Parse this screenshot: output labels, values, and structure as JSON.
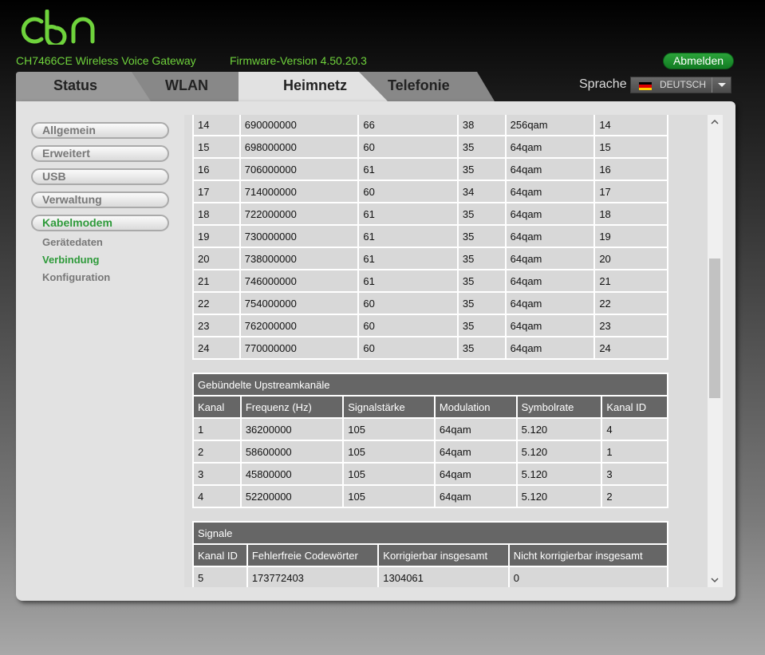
{
  "header": {
    "model": "CH7466CE  Wireless Voice Gateway",
    "firmware": "Firmware-Version  4.50.20.3",
    "logout_label": "Abmelden",
    "language_label": "Sprache",
    "language_value": "DEUTSCH",
    "brand_color": "#6fd33c"
  },
  "tabs": [
    "Status",
    "WLAN",
    "Heimnetz",
    "Telefonie"
  ],
  "sidebar": {
    "buttons": [
      "Allgemein",
      "Erweitert",
      "USB",
      "Verwaltung",
      "Kabelmodem"
    ],
    "subitems": [
      "Gerätedaten",
      "Verbindung",
      "Konfiguration"
    ]
  },
  "downstream_rows": [
    [
      "14",
      "690000000",
      "66",
      "38",
      "256qam",
      "14"
    ],
    [
      "15",
      "698000000",
      "60",
      "35",
      "64qam",
      "15"
    ],
    [
      "16",
      "706000000",
      "61",
      "35",
      "64qam",
      "16"
    ],
    [
      "17",
      "714000000",
      "60",
      "34",
      "64qam",
      "17"
    ],
    [
      "18",
      "722000000",
      "61",
      "35",
      "64qam",
      "18"
    ],
    [
      "19",
      "730000000",
      "61",
      "35",
      "64qam",
      "19"
    ],
    [
      "20",
      "738000000",
      "61",
      "35",
      "64qam",
      "20"
    ],
    [
      "21",
      "746000000",
      "61",
      "35",
      "64qam",
      "21"
    ],
    [
      "22",
      "754000000",
      "60",
      "35",
      "64qam",
      "22"
    ],
    [
      "23",
      "762000000",
      "60",
      "35",
      "64qam",
      "23"
    ],
    [
      "24",
      "770000000",
      "60",
      "35",
      "64qam",
      "24"
    ]
  ],
  "upstream": {
    "title": "Gebündelte Upstreamkanäle",
    "headers": [
      "Kanal",
      "Frequenz (Hz)",
      "Signalstärke",
      "Modulation",
      "Symbolrate",
      "Kanal ID"
    ],
    "rows": [
      [
        "1",
        "36200000",
        "105",
        "64qam",
        "5.120",
        "4"
      ],
      [
        "2",
        "58600000",
        "105",
        "64qam",
        "5.120",
        "1"
      ],
      [
        "3",
        "45800000",
        "105",
        "64qam",
        "5.120",
        "3"
      ],
      [
        "4",
        "52200000",
        "105",
        "64qam",
        "5.120",
        "2"
      ]
    ]
  },
  "signal": {
    "title": "Signale",
    "headers": [
      "Kanal ID",
      "Fehlerfreie Codewörter",
      "Korrigierbar insgesamt",
      "Nicht korrigierbar insgesamt"
    ],
    "rows": [
      [
        "5",
        "173772403",
        "1304061",
        "0"
      ]
    ]
  }
}
